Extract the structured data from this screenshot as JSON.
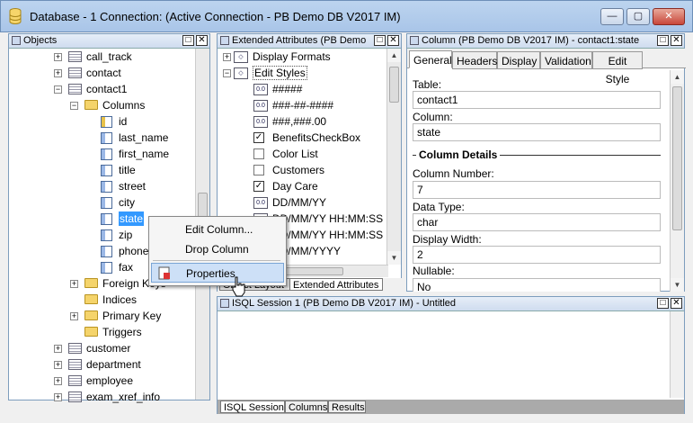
{
  "window": {
    "title": "Database - 1 Connection: (Active Connection - PB Demo DB V2017 IM)",
    "controls": {
      "minimize": "—",
      "maximize": "▢",
      "close": "✕"
    }
  },
  "objects_pane": {
    "title": "Objects",
    "tree": [
      {
        "label": "call_track",
        "kind": "table"
      },
      {
        "label": "contact",
        "kind": "table"
      },
      {
        "label": "contact1",
        "kind": "table"
      },
      {
        "label": "Columns",
        "kind": "folder"
      },
      {
        "label": "id",
        "kind": "column"
      },
      {
        "label": "last_name",
        "kind": "column"
      },
      {
        "label": "first_name",
        "kind": "column"
      },
      {
        "label": "title",
        "kind": "column"
      },
      {
        "label": "street",
        "kind": "column"
      },
      {
        "label": "city",
        "kind": "column"
      },
      {
        "label": "state",
        "kind": "column"
      },
      {
        "label": "zip",
        "kind": "column"
      },
      {
        "label": "phone",
        "kind": "column"
      },
      {
        "label": "fax",
        "kind": "column"
      },
      {
        "label": "Foreign Keys",
        "kind": "folder"
      },
      {
        "label": "Indices",
        "kind": "folder"
      },
      {
        "label": "Primary Key",
        "kind": "folder"
      },
      {
        "label": "Triggers",
        "kind": "folder"
      },
      {
        "label": "customer",
        "kind": "table"
      },
      {
        "label": "department",
        "kind": "table"
      },
      {
        "label": "employee",
        "kind": "table"
      },
      {
        "label": "exam_xref_info",
        "kind": "table"
      }
    ]
  },
  "context_menu": {
    "items": [
      "Edit Column...",
      "Drop Column",
      "Properties"
    ],
    "highlighted": "Properties"
  },
  "ext_attr_pane": {
    "title": "Extended Attributes (PB Demo",
    "items": [
      {
        "label": "Display Formats",
        "kind": "group"
      },
      {
        "label": "Edit Styles",
        "kind": "group"
      },
      {
        "label": "#####",
        "kind": "style"
      },
      {
        "label": "###-##-####",
        "kind": "style"
      },
      {
        "label": "###,###.00",
        "kind": "style"
      },
      {
        "label": "BenefitsCheckBox",
        "kind": "check"
      },
      {
        "label": "Color List",
        "kind": "list"
      },
      {
        "label": "Customers",
        "kind": "list"
      },
      {
        "label": "Day Care",
        "kind": "check"
      },
      {
        "label": "DD/MM/YY",
        "kind": "style"
      },
      {
        "label": "DD/MM/YY HH:MM:SS",
        "kind": "style"
      },
      {
        "label": "DD/MM/YY HH:MM:SS",
        "kind": "style"
      },
      {
        "label": "DD/MM/YYYY",
        "kind": "style"
      }
    ],
    "tabs": [
      "Object Layout",
      "Extended Attributes"
    ]
  },
  "column_pane": {
    "title": "Column (PB Demo DB V2017 IM) - contact1:state",
    "tabs": [
      "General",
      "Headers",
      "Display",
      "Validation",
      "Edit Style"
    ],
    "active_tab": "General",
    "table_label": "Table:",
    "table_value": "contact1",
    "column_label": "Column:",
    "column_value": "state",
    "section_title": "Column Details",
    "number_label": "Column Number:",
    "number_value": "7",
    "type_label": "Data Type:",
    "type_value": "char",
    "width_label": "Display Width:",
    "width_value": "2",
    "nullable_label": "Nullable:",
    "nullable_value": "No"
  },
  "isql_pane": {
    "title": "ISQL Session 1 (PB Demo DB V2017 IM) - Untitled",
    "tabs": [
      "ISQL Session",
      "Columns",
      "Results"
    ]
  }
}
